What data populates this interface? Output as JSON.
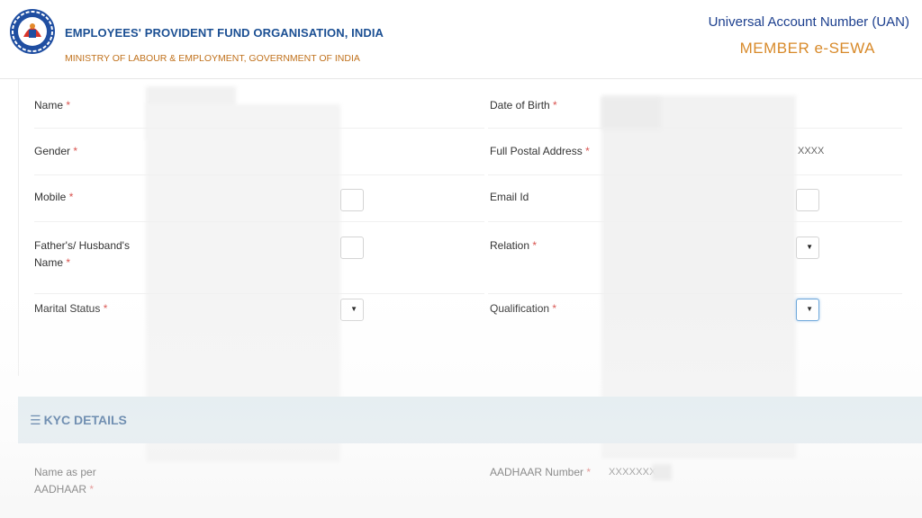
{
  "header": {
    "org_name": "EMPLOYEES' PROVIDENT FUND ORGANISATION, INDIA",
    "ministry": "MINISTRY OF LABOUR & EMPLOYMENT, GOVERNMENT OF INDIA",
    "portal_title": "Universal Account Number (UAN)",
    "portal_subtitle": "MEMBER e-SEWA",
    "logo_icon": "epfo-logo-icon"
  },
  "form": {
    "required_mark": "*",
    "name_label": "Name",
    "dob_label": "Date of Birth",
    "gender_label": "Gender",
    "postal_label": "Full Postal Address",
    "postal_value_suffix": "XXXX",
    "mobile_label": "Mobile",
    "email_label": "Email Id",
    "father_label_line1": "Father's/ Husband's",
    "father_label_line2": "Name",
    "relation_label": "Relation",
    "marital_label": "Marital Status",
    "qualification_label": "Qualification"
  },
  "kyc": {
    "title": "KYC DETAILS",
    "icon": "list-icon",
    "name_aadhaar_line1": "Name as per",
    "name_aadhaar_line2": "AADHAAR",
    "aadhaar_label": "AADHAAR Number",
    "aadhaar_value": "XXXXXXXX"
  },
  "colors": {
    "org_blue": "#1b4f93",
    "ministry_orange": "#c0711c",
    "sewa_orange": "#d88a2a",
    "required_red": "#d9534f",
    "kyc_bar": "#dde9ee"
  }
}
